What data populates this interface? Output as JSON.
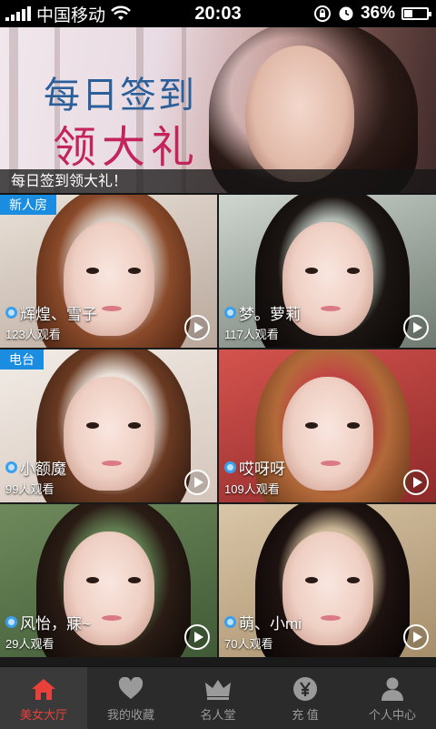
{
  "status_bar": {
    "carrier": "中国移动",
    "time": "20:03",
    "battery_pct": "36%",
    "battery_level": 0.36,
    "icons": [
      "signal-icon",
      "wifi-icon",
      "rotation-lock-icon",
      "alarm-icon",
      "battery-icon"
    ]
  },
  "banner": {
    "title_line1": "每日签到",
    "title_line2": "领大礼",
    "caption": "每日签到领大礼！"
  },
  "rooms": [
    {
      "badge": "新人房",
      "name": "辉煌、雪子",
      "viewers": "123人观看",
      "theme": "warm"
    },
    {
      "badge": "",
      "name": "梦。萝莉",
      "viewers": "117人观看",
      "theme": "dark"
    },
    {
      "badge": "电台",
      "name": "小额魔",
      "viewers": "99人观看",
      "theme": "light"
    },
    {
      "badge": "",
      "name": "哎呀呀",
      "viewers": "109人观看",
      "theme": "red"
    },
    {
      "badge": "",
      "name": "风怡，寐~",
      "viewers": "29人观看",
      "theme": "green"
    },
    {
      "badge": "",
      "name": "萌、小mi",
      "viewers": "70人观看",
      "theme": "warm2"
    }
  ],
  "tabs": [
    {
      "label": "美女大厅",
      "icon": "home-icon",
      "active": true
    },
    {
      "label": "我的收藏",
      "icon": "heart-icon",
      "active": false
    },
    {
      "label": "名人堂",
      "icon": "crown-icon",
      "active": false
    },
    {
      "label": "充  值",
      "icon": "yen-icon",
      "active": false
    },
    {
      "label": "个人中心",
      "icon": "person-icon",
      "active": false
    }
  ],
  "colors": {
    "accent_blue": "#1b8de0",
    "tab_active": "#e9413a",
    "tab_inactive": "#9a9a9a",
    "banner_title": "#2a5f99",
    "banner_sub": "#c2245b"
  }
}
